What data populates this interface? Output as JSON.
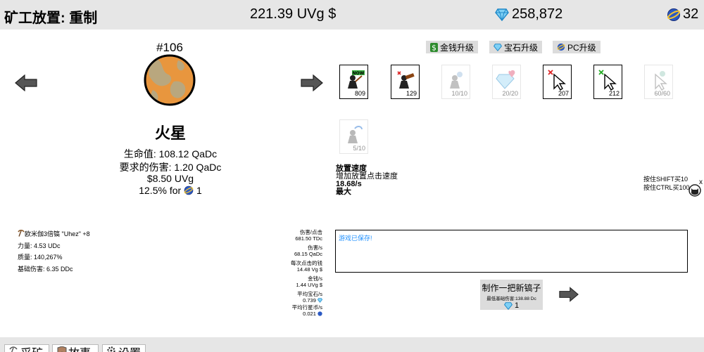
{
  "header": {
    "title": "矿工放置: 重制",
    "money": "221.39 UVg $",
    "gems": "258,872",
    "planet_coins": "32"
  },
  "planet": {
    "number": "#106",
    "name": "火星",
    "health": "生命值: 108.12 QaDc",
    "required_damage": "要求的伤害: 1.20 QaDc",
    "reward_money": "$8.50 UVg",
    "coin_chance": "12.5% for",
    "coin_amount": "1"
  },
  "pickaxe": {
    "name": "欧米伽3倍镐 \"Uhez\" +8",
    "strength": "力量: 4.53 UDc",
    "quality": "质量: 140,267%",
    "base_damage": "基础伤害: 6.35 DDc"
  },
  "upgrade_tabs": {
    "money": "金钱升级",
    "gems": "宝石升级",
    "pc": "PC升级"
  },
  "upgrades": [
    {
      "count": "809",
      "icon": "auto-miner-now-icon",
      "enabled": true
    },
    {
      "count": "129",
      "icon": "auto-miner-hammer-icon",
      "enabled": true
    },
    {
      "count": "10/10",
      "icon": "miner-ghost-icon",
      "enabled": false
    },
    {
      "count": "20/20",
      "icon": "gem-heart-icon",
      "enabled": false
    },
    {
      "count": "207",
      "icon": "cursor-red-icon",
      "enabled": true
    },
    {
      "count": "212",
      "icon": "cursor-green-icon",
      "enabled": true
    },
    {
      "count": "60/60",
      "icon": "cursor-ghost-icon",
      "enabled": false
    },
    {
      "count": "5/10",
      "icon": "miner-blue-icon",
      "enabled": false
    }
  ],
  "upgrade_desc": {
    "title": "放置速度",
    "text": "增加放置点击速度",
    "value": "18.68/s",
    "status": "最大"
  },
  "hints": {
    "shift": "按住SHIFT买10",
    "ctrl": "按住CTRL买100",
    "close": "x"
  },
  "stats": {
    "dmg_click_label": "伤害/点击",
    "dmg_click": "681.50 TDc",
    "dmg_sec_label": "伤害/s",
    "dmg_sec": "68.15 QaDc",
    "money_click_label": "每次点击的钱",
    "money_click": "14.48 Vg $",
    "money_sec_label": "金钱/s",
    "money_sec": "1.44 UVg $",
    "gems_sec_label": "平均宝石/s",
    "gems_sec": "0.739",
    "pc_sec_label": "平均行星币/s",
    "pc_sec": "0.021"
  },
  "log": {
    "message": "游戏已保存!"
  },
  "craft": {
    "title": "制作一把新镐子",
    "min_base": "最低基础伤害:138.88 Dc",
    "cost": "1"
  },
  "bottom_tabs": {
    "mining": "采矿",
    "story": "故事",
    "settings": "设置"
  },
  "colors": {
    "bar": "#e6e6e6",
    "tab": "#dcdcdc",
    "gem": "#1e88c8",
    "log_text": "#1e90ff",
    "planet_orange": "#e8963e",
    "planet_khaki": "#b9a77e"
  }
}
